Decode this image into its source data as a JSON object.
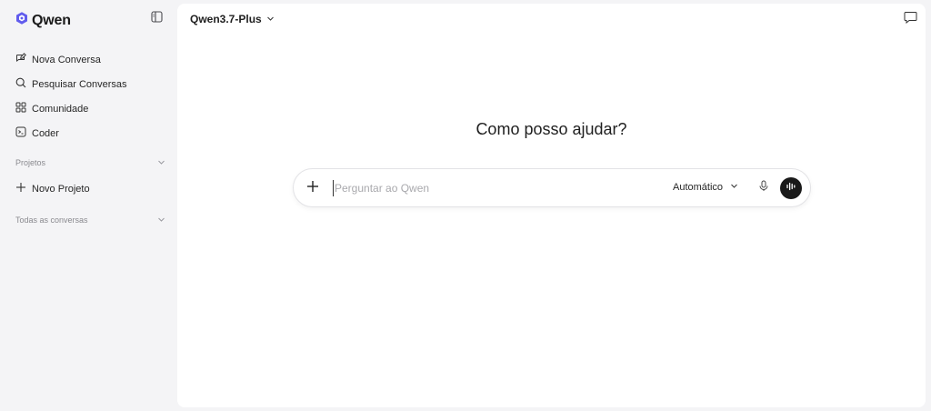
{
  "brand": {
    "name": "Qwen",
    "accent": "#615ced"
  },
  "sidebar": {
    "items": [
      {
        "label": "Nova Conversa",
        "icon": "new-chat-icon"
      },
      {
        "label": "Pesquisar Conversas",
        "icon": "search-icon"
      },
      {
        "label": "Comunidade",
        "icon": "grid-icon"
      },
      {
        "label": "Coder",
        "icon": "terminal-icon"
      }
    ],
    "projects_heading": "Projetos",
    "new_project_label": "Novo Projeto",
    "all_conversations_heading": "Todas as conversas"
  },
  "header": {
    "model": "Qwen3.7-Plus"
  },
  "main": {
    "headline": "Como posso ajudar?",
    "input_placeholder": "Perguntar ao Qwen",
    "mode_label": "Automático"
  }
}
